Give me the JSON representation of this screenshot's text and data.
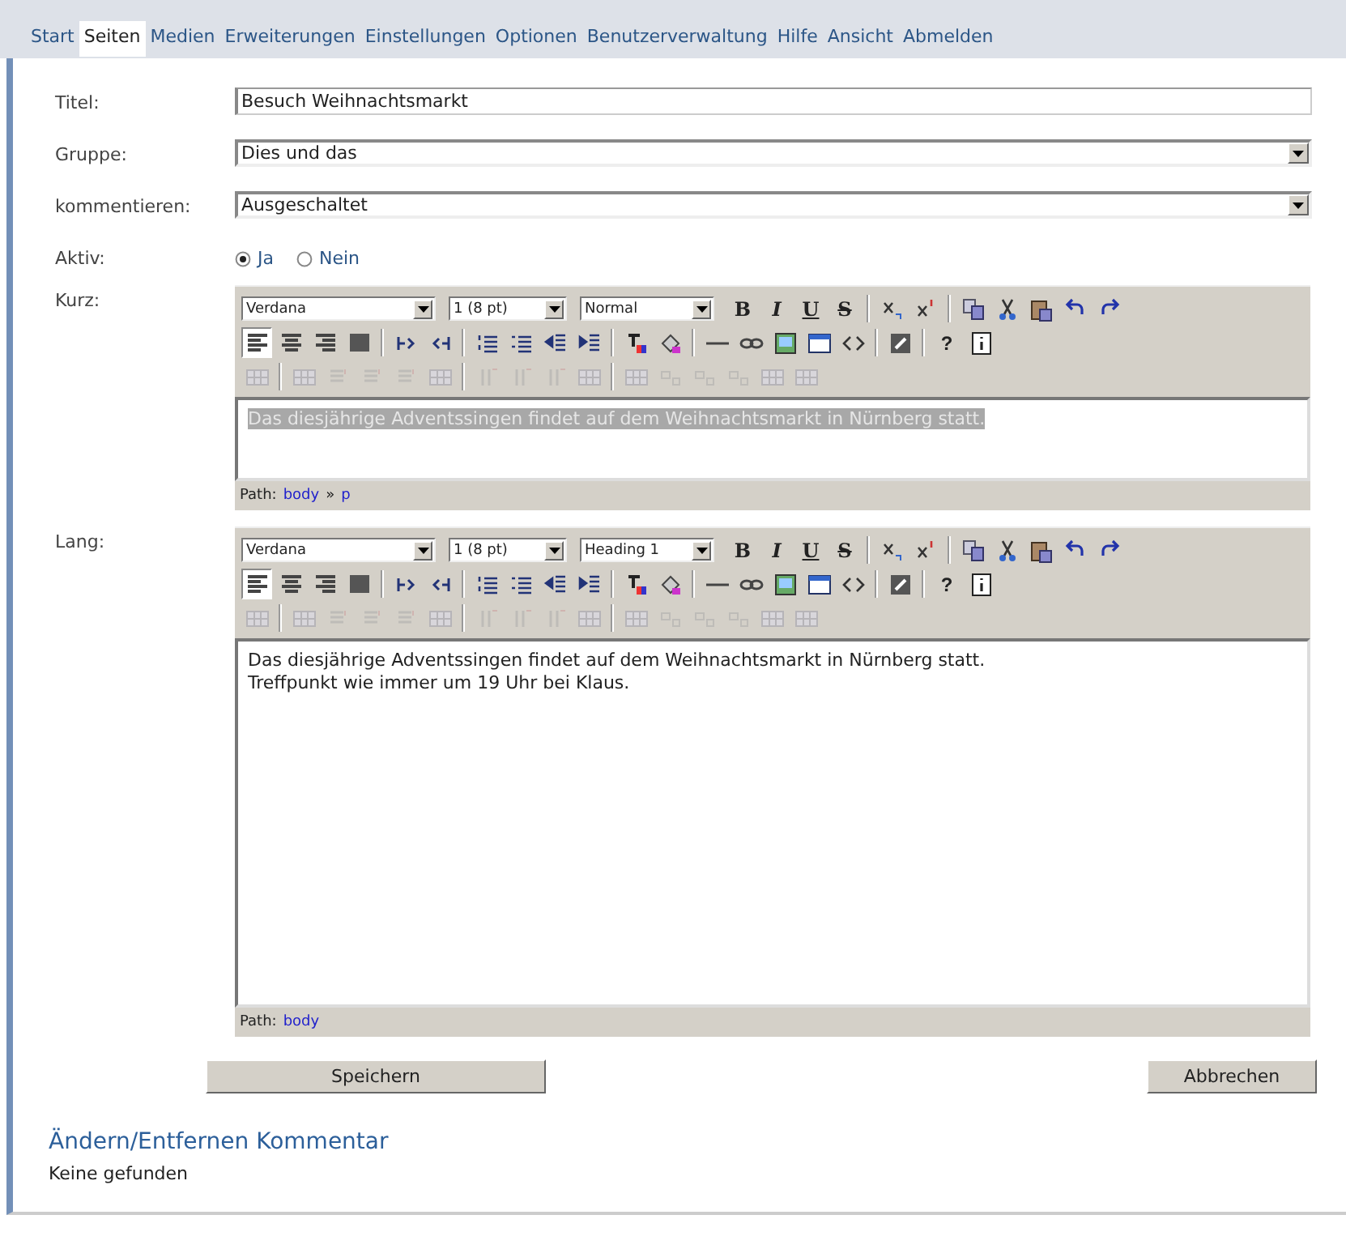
{
  "tabs": [
    {
      "label": "Start",
      "selected": false
    },
    {
      "label": "Seiten",
      "selected": true
    },
    {
      "label": "Medien",
      "selected": false
    },
    {
      "label": "Erweiterungen",
      "selected": false
    },
    {
      "label": "Einstellungen",
      "selected": false
    },
    {
      "label": "Optionen",
      "selected": false
    },
    {
      "label": "Benutzerverwaltung",
      "selected": false
    },
    {
      "label": "Hilfe",
      "selected": false
    },
    {
      "label": "Ansicht",
      "selected": false
    },
    {
      "label": "Abmelden",
      "selected": false
    }
  ],
  "form": {
    "title": {
      "label": "Titel:",
      "value": "Besuch Weihnachtsmarkt"
    },
    "group": {
      "label": "Gruppe:",
      "value": "Dies und das"
    },
    "comments": {
      "label": "kommentieren:",
      "value": "Ausgeschaltet"
    },
    "active": {
      "label": "Aktiv:",
      "options": [
        {
          "label": "Ja",
          "selected": true
        },
        {
          "label": "Nein",
          "selected": false
        }
      ]
    },
    "editors": [
      {
        "label": "Kurz:",
        "toolbar": {
          "font": "Verdana",
          "size": "1 (8 pt)",
          "format": "Normal",
          "bold": "B",
          "italic": "I",
          "underline": "U",
          "strike": "S",
          "help": "?",
          "align_left_on": true
        },
        "content": [
          "Das diesjährige Adventssingen findet auf dem Weihnachtsmarkt in Nürnberg statt."
        ],
        "content_selected": true,
        "path_label": "Path:",
        "path": [
          {
            "kind": "link",
            "text": "body"
          },
          {
            "kind": "sep",
            "text": "»"
          },
          {
            "kind": "link",
            "text": "p"
          }
        ]
      },
      {
        "label": "Lang:",
        "toolbar": {
          "font": "Verdana",
          "size": "1 (8 pt)",
          "format": "Heading 1",
          "bold": "B",
          "italic": "I",
          "underline": "U",
          "strike": "S",
          "help": "?",
          "align_left_on": true
        },
        "content": [
          "Das diesjährige Adventssingen findet auf dem Weihnachtsmarkt in Nürnberg statt.",
          "Treffpunkt wie immer um 19 Uhr bei Klaus."
        ],
        "content_selected": false,
        "path_label": "Path:",
        "path": [
          {
            "kind": "link",
            "text": "body"
          }
        ]
      }
    ],
    "buttons": {
      "save": "Speichern",
      "cancel": "Abbrechen"
    }
  },
  "comments_section": {
    "heading": "Ändern/Entfernen Kommentar",
    "empty": "Keine gefunden"
  }
}
